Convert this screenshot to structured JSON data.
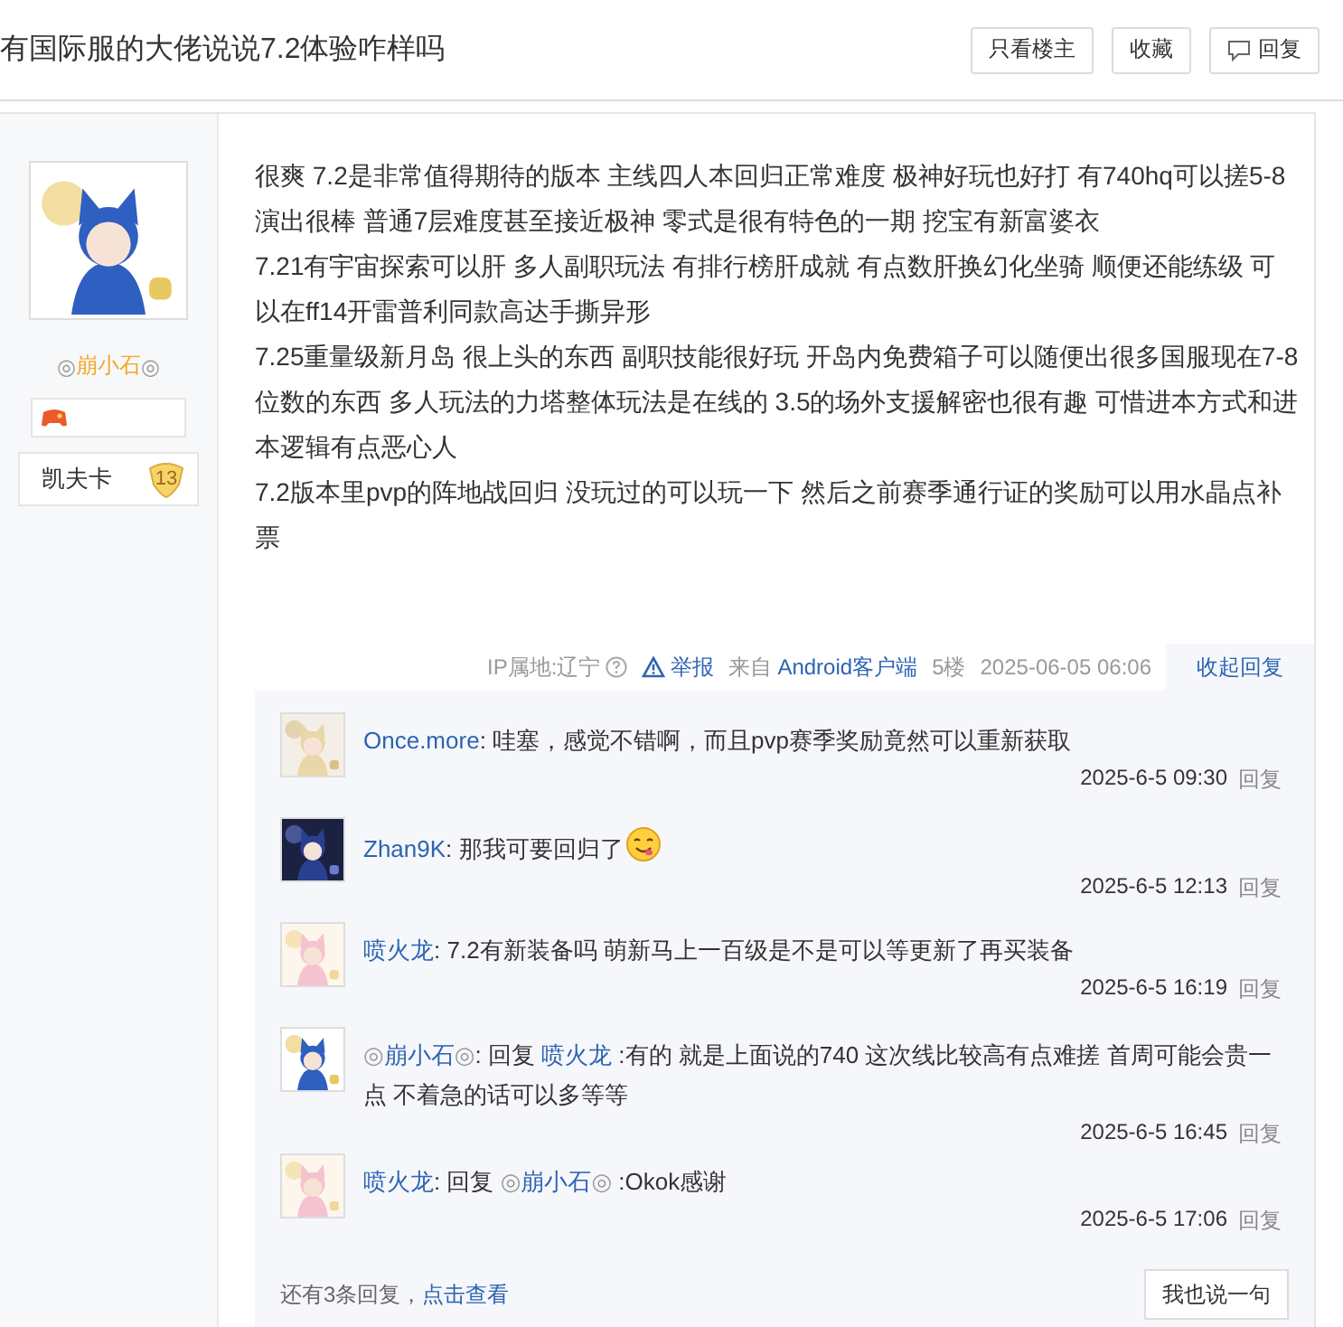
{
  "thread": {
    "title": "有国际服的大佬说说7.2体验咋样吗",
    "buttons": [
      {
        "kind": "plain",
        "label": "只看楼主"
      },
      {
        "kind": "plain",
        "label": "收藏"
      },
      {
        "kind": "reply",
        "label": "回复"
      }
    ]
  },
  "author": {
    "mark_left": "◎",
    "name": "崩小石",
    "mark_right": "◎",
    "badge_name": "凯夫卡",
    "badge_level": "13"
  },
  "post": {
    "paragraphs": [
      "很爽 7.2是非常值得期待的版本 主线四人本回归正常难度 极神好玩也好打 有740hq可以搓5-8演出很棒 普通7层难度甚至接近极神 零式是很有特色的一期 挖宝有新富婆衣",
      "7.21有宇宙探索可以肝 多人副职玩法 有排行榜肝成就 有点数肝换幻化坐骑 顺便还能练级 可以在ff14开雷普利同款高达手撕异形",
      "7.25重量级新月岛 很上头的东西 副职技能很好玩 开岛内免费箱子可以随便出很多国服现在7-8位数的东西 多人玩法的力塔整体玩法是在线的 3.5的场外支援解密也很有趣 可惜进本方式和进本逻辑有点恶心人",
      "7.2版本里pvp的阵地战回归 没玩过的可以玩一下 然后之前赛季通行证的奖励可以用水晶点补票"
    ],
    "ip": "IP属地:辽宁",
    "report": "举报",
    "from": "来自",
    "client": "Android客户端",
    "floor": "5楼",
    "time": "2025-06-05 06:06",
    "collapse": "收起回复"
  },
  "comments": [
    {
      "author": [
        {
          "kind": "name",
          "text": "Once.more"
        }
      ],
      "body": [
        {
          "kind": "text",
          "text": ": 哇塞，感觉不错啊，而且pvp赛季奖励竟然可以重新获取"
        }
      ],
      "time": "2025-6-5 09:30",
      "reply": "回复"
    },
    {
      "author": [
        {
          "kind": "name",
          "text": "Zhan9K"
        }
      ],
      "body": [
        {
          "kind": "text",
          "text": ": 那我可要回归了"
        },
        {
          "kind": "emoji"
        }
      ],
      "time": "2025-6-5 12:13",
      "reply": "回复"
    },
    {
      "author": [
        {
          "kind": "name",
          "text": "喷火龙"
        }
      ],
      "body": [
        {
          "kind": "text",
          "text": ": 7.2有新装备吗 萌新马上一百级是不是可以等更新了再买装备"
        }
      ],
      "time": "2025-6-5 16:19",
      "reply": "回复"
    },
    {
      "author": [
        {
          "kind": "mark",
          "text": "◎"
        },
        {
          "kind": "name",
          "text": "崩小石"
        },
        {
          "kind": "mark",
          "text": "◎"
        }
      ],
      "body": [
        {
          "kind": "text",
          "text": ": 回复 "
        },
        {
          "kind": "name",
          "text": "喷火龙"
        },
        {
          "kind": "text",
          "text": " :有的 就是上面说的740 这次线比较高有点难搓 首周可能会贵一点 不着急的话可以多等等"
        }
      ],
      "time": "2025-6-5 16:45",
      "reply": "回复"
    },
    {
      "author": [
        {
          "kind": "name",
          "text": "喷火龙"
        }
      ],
      "body": [
        {
          "kind": "text",
          "text": ": 回复 "
        },
        {
          "kind": "mark",
          "text": "◎"
        },
        {
          "kind": "name",
          "text": "崩小石"
        },
        {
          "kind": "mark",
          "text": "◎"
        },
        {
          "kind": "text",
          "text": " :Okok感谢"
        }
      ],
      "time": "2025-6-5 17:06",
      "reply": "回复"
    }
  ],
  "more": {
    "text": "还有3条回复，",
    "link": "点击查看",
    "button": "我也说一句"
  }
}
